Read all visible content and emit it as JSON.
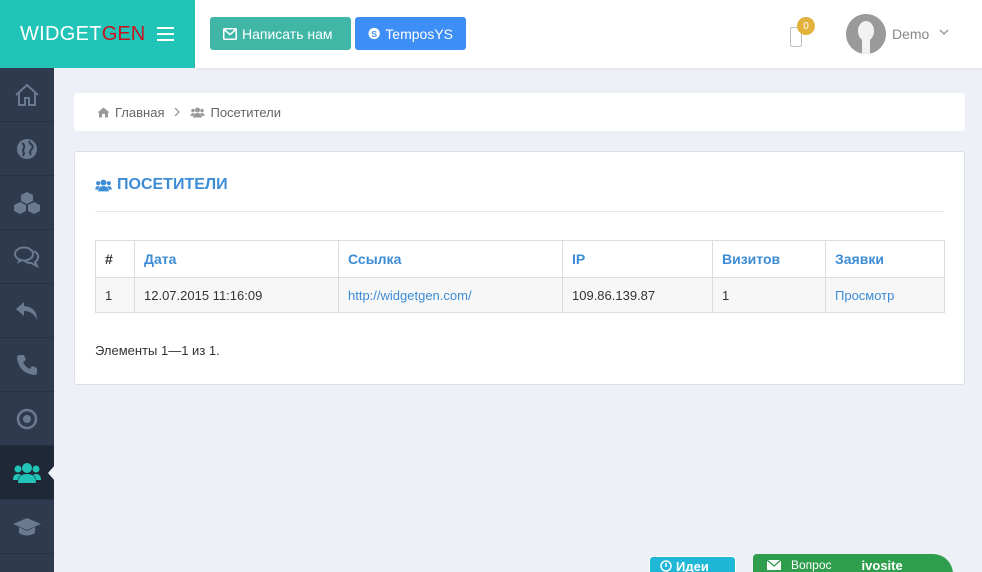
{
  "app": {
    "logo_main": "WIDGET",
    "logo_accent": "GEN",
    "brand_accent_color": "#22c4b7"
  },
  "header": {
    "write_button": "Написать нам",
    "skype_button": "TemposYS",
    "notification_count": "0",
    "user_name": "Demo"
  },
  "sidebar": {
    "items": [
      {
        "icon": "home-icon"
      },
      {
        "icon": "globe-icon"
      },
      {
        "icon": "cubes-icon"
      },
      {
        "icon": "comments-icon"
      },
      {
        "icon": "reply-icon"
      },
      {
        "icon": "phone-icon"
      },
      {
        "icon": "target-icon"
      },
      {
        "icon": "users-icon",
        "active": true
      },
      {
        "icon": "graduation-cap-icon"
      }
    ]
  },
  "breadcrumb": {
    "home": "Главная",
    "current": "Посетители"
  },
  "panel": {
    "title": "ПОСЕТИТЕЛИ",
    "columns": [
      "#",
      "Дата",
      "Ссылка",
      "IP",
      "Визитов",
      "Заявки"
    ],
    "rows": [
      {
        "num": "1",
        "date": "12.07.2015 11:16:09",
        "link": "http://widgetgen.com/",
        "ip": "109.86.139.87",
        "visits": "1",
        "requests": "Просмотр"
      }
    ],
    "summary": "Элементы 1—1 из 1."
  },
  "widgets": {
    "ideas": "Идеи",
    "question": "Вопрос",
    "brand": "ivosite"
  }
}
